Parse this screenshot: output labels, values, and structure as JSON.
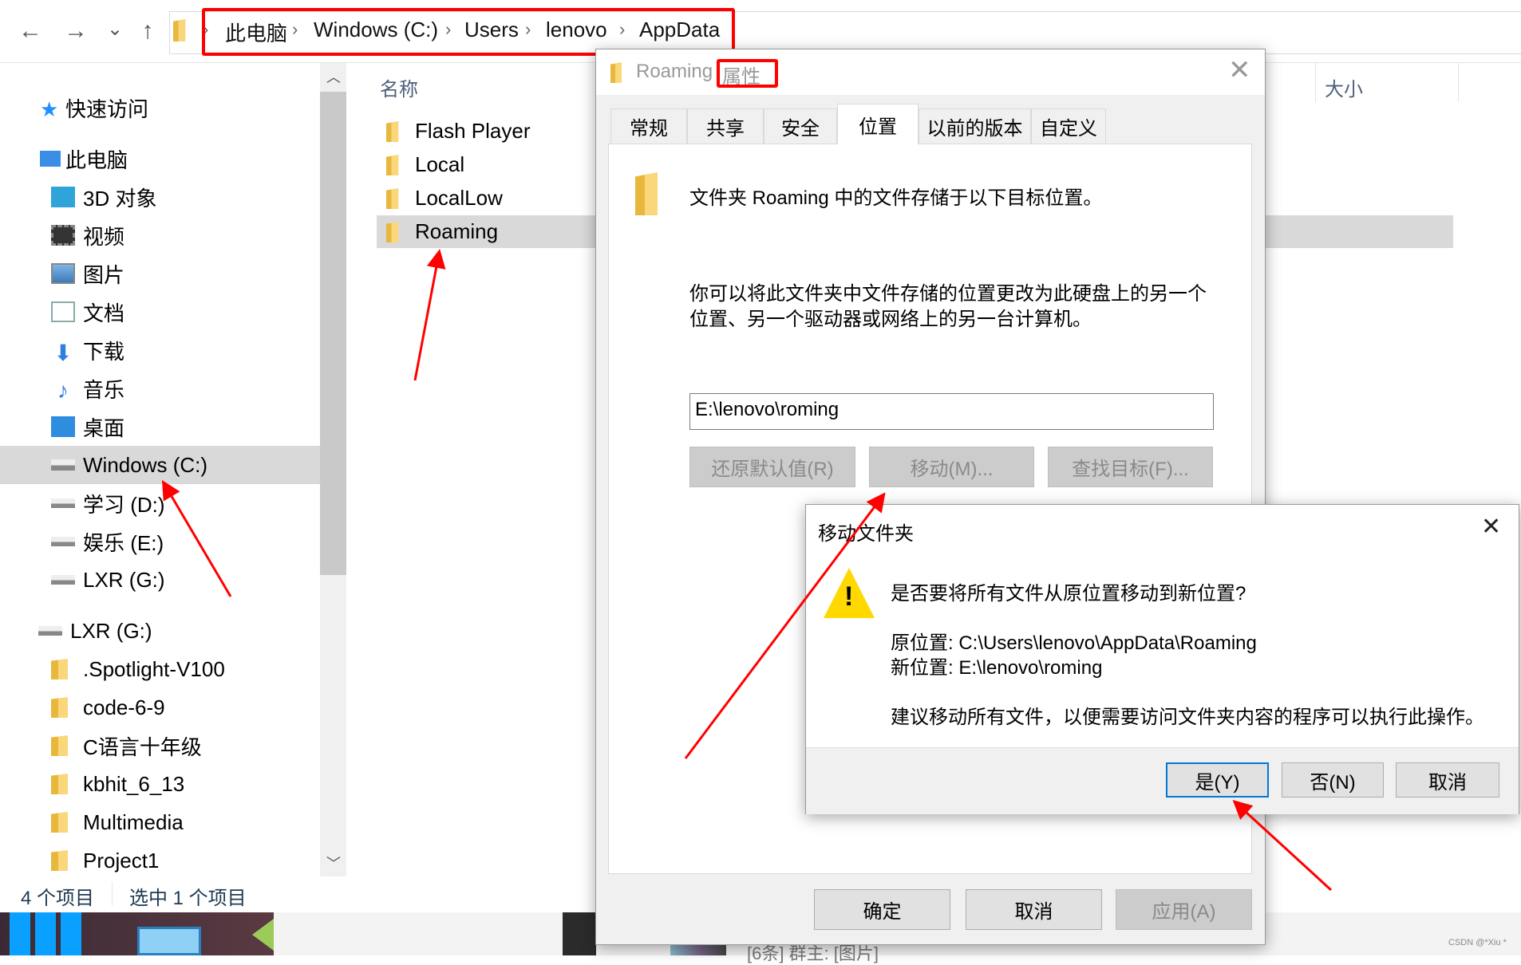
{
  "explorer": {
    "breadcrumb": [
      "此电脑",
      "Windows (C:)",
      "Users",
      "lenovo",
      "AppData"
    ],
    "nav_buttons": {
      "back": "←",
      "forward": "→",
      "recent": "⌄",
      "up": "↑"
    },
    "nav_pane": [
      {
        "label": "快速访问",
        "icon": "star-icon"
      },
      {
        "label": "此电脑",
        "icon": "computer-icon"
      },
      {
        "label": "3D 对象",
        "icon": "3d-objects-icon"
      },
      {
        "label": "视频",
        "icon": "video-icon"
      },
      {
        "label": "图片",
        "icon": "pictures-icon"
      },
      {
        "label": "文档",
        "icon": "documents-icon"
      },
      {
        "label": "下载",
        "icon": "download-icon"
      },
      {
        "label": "音乐",
        "icon": "music-icon"
      },
      {
        "label": "桌面",
        "icon": "desktop-icon"
      },
      {
        "label": "Windows (C:)",
        "icon": "drive-c-icon",
        "selected": true
      },
      {
        "label": "学习 (D:)",
        "icon": "drive-icon"
      },
      {
        "label": "娱乐 (E:)",
        "icon": "drive-icon"
      },
      {
        "label": "LXR (G:)",
        "icon": "drive-icon"
      },
      {
        "label": "LXR (G:)",
        "icon": "drive-icon"
      },
      {
        "label": ".Spotlight-V100",
        "icon": "folder-icon"
      },
      {
        "label": "code-6-9",
        "icon": "folder-icon"
      },
      {
        "label": "C语言十年级",
        "icon": "folder-icon"
      },
      {
        "label": "kbhit_6_13",
        "icon": "folder-icon"
      },
      {
        "label": "Multimedia",
        "icon": "folder-icon"
      },
      {
        "label": "Project1",
        "icon": "folder-icon"
      }
    ],
    "columns": {
      "name": "名称",
      "size": "大小"
    },
    "files": [
      "Flash Player",
      "Local",
      "LocalLow",
      "Roaming"
    ],
    "selected_file": "Roaming",
    "status": {
      "count": "4 个项目",
      "selected": "选中 1 个项目"
    }
  },
  "properties": {
    "title_folder": "Roaming",
    "title_suffix": "属性",
    "tabs": [
      "常规",
      "共享",
      "安全",
      "位置",
      "以前的版本",
      "自定义"
    ],
    "active_tab": "位置",
    "desc": "文件夹 Roaming 中的文件存储于以下目标位置。",
    "para1": "你可以将此文件夹中文件存储的位置更改为此硬盘上的另一个",
    "para2": "位置、另一个驱动器或网络上的另一台计算机。",
    "path_value": "E:\\lenovo\\roming",
    "restore_btn": "还原默认值(R)",
    "move_btn": "移动(M)...",
    "find_btn": "查找目标(F)...",
    "ok": "确定",
    "cancel": "取消",
    "apply": "应用(A)"
  },
  "move_dialog": {
    "title": "移动文件夹",
    "question": "是否要将所有文件从原位置移动到新位置?",
    "old_loc": "原位置: C:\\Users\\lenovo\\AppData\\Roaming",
    "new_loc": "新位置: E:\\lenovo\\roming",
    "advice": "建议移动所有文件，以便需要访问文件夹内容的程序可以执行此操作。",
    "yes": "是(Y)",
    "no": "否(N)",
    "cancel": "取消"
  },
  "taskbar": {
    "chat_preview": "[6条] 群主: [图片]"
  },
  "watermark": "CSDN @*Xiu *",
  "colors": {
    "annotation": "#ff0000",
    "selection": "#d9d9d9",
    "dialog_bg": "#f0f0f0",
    "focus_border": "#0078d7"
  }
}
